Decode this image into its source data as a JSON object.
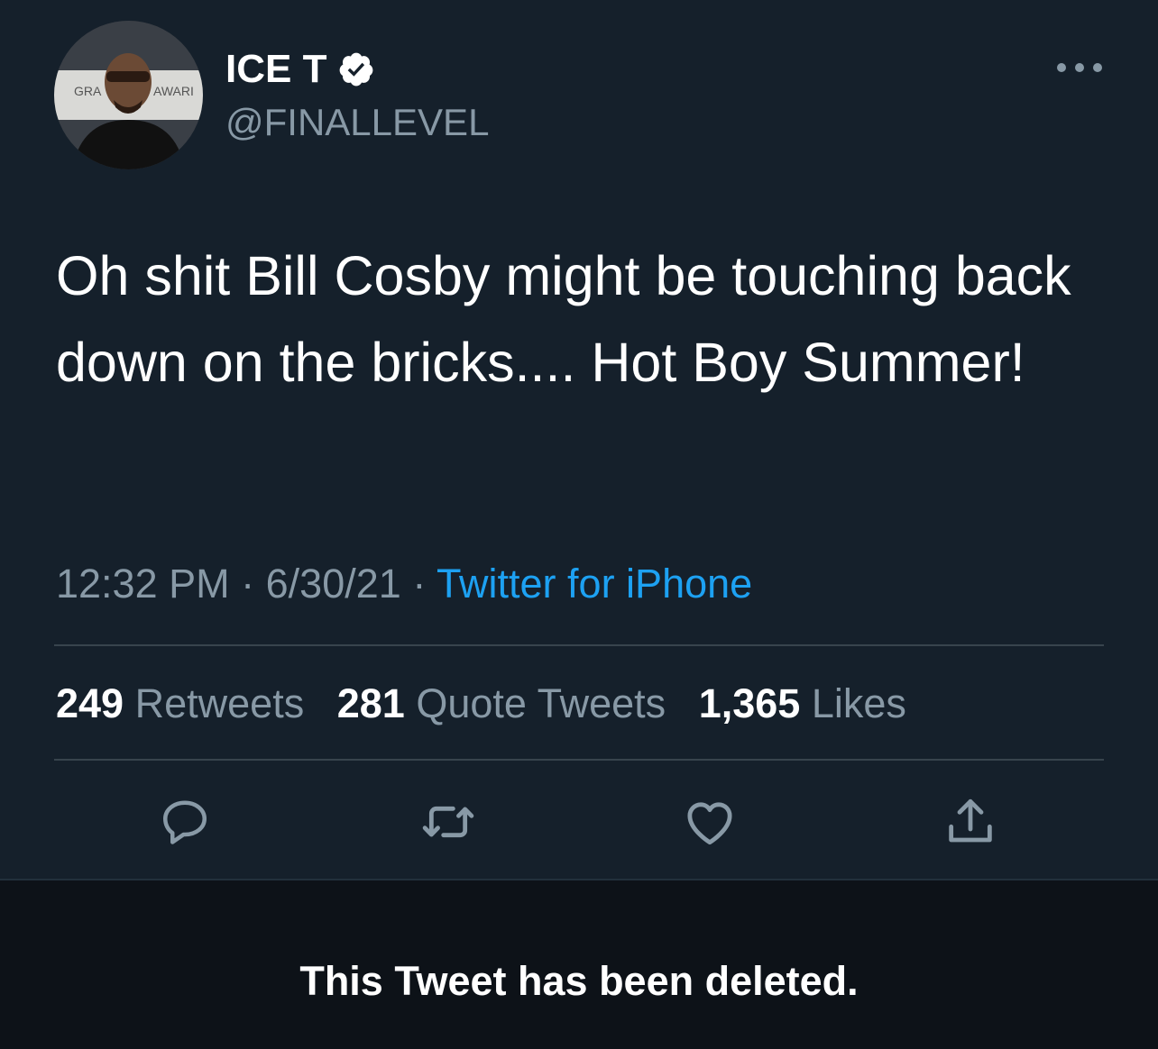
{
  "user": {
    "display_name": "ICE T",
    "handle": "@FINALLEVEL",
    "verified": true,
    "avatar_backdrop_text_left": "GRA",
    "avatar_backdrop_text_right": "AWARI"
  },
  "tweet": {
    "text": "Oh shit Bill Cosby might be touching back down on the bricks.... Hot Boy Summer!",
    "time": "12:32 PM",
    "date": "6/30/21",
    "separator": "·",
    "source": "Twitter for iPhone"
  },
  "stats": {
    "retweets_count": "249",
    "retweets_label": "Retweets",
    "quotes_count": "281",
    "quotes_label": "Quote Tweets",
    "likes_count": "1,365",
    "likes_label": "Likes"
  },
  "actions": [
    {
      "icon": "reply-icon"
    },
    {
      "icon": "retweet-icon"
    },
    {
      "icon": "heart-icon"
    },
    {
      "icon": "share-icon"
    }
  ],
  "notice": {
    "deleted_text": "This Tweet has been deleted."
  },
  "colors": {
    "background": "#15202b",
    "secondary_text": "#8899a6",
    "link": "#1da1f2",
    "divider": "#38444d",
    "deleted_bar": "#0d1218"
  }
}
